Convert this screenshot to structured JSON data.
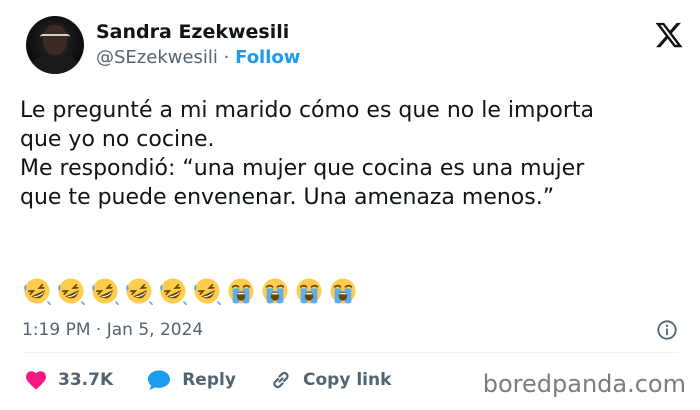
{
  "author": {
    "display_name": "Sandra Ezekwesili",
    "handle": "@SEzekwesili",
    "separator": "·",
    "follow_label": "Follow"
  },
  "tweet": {
    "lines": [
      "Le pregunté a mi marido cómo es que no le importa",
      "que yo no cocine.",
      "Me respondió: “una mujer que cocina es una mujer",
      "que te puede envenenar. Una amenaza menos.”"
    ],
    "emojis": [
      "rolling-on-floor-laughing",
      "rolling-on-floor-laughing",
      "rolling-on-floor-laughing",
      "rolling-on-floor-laughing",
      "rolling-on-floor-laughing",
      "rolling-on-floor-laughing",
      "loudly-crying-face",
      "loudly-crying-face",
      "loudly-crying-face",
      "loudly-crying-face"
    ],
    "timestamp": "1:19 PM · Jan 5, 2024"
  },
  "actions": {
    "likes": "33.7K",
    "reply_label": "Reply",
    "copy_link_label": "Copy link"
  },
  "watermark": "boredpanda.com",
  "colors": {
    "accent": "#1d9bf0",
    "like": "#f91880",
    "muted": "#536471",
    "text": "#0f1419"
  }
}
